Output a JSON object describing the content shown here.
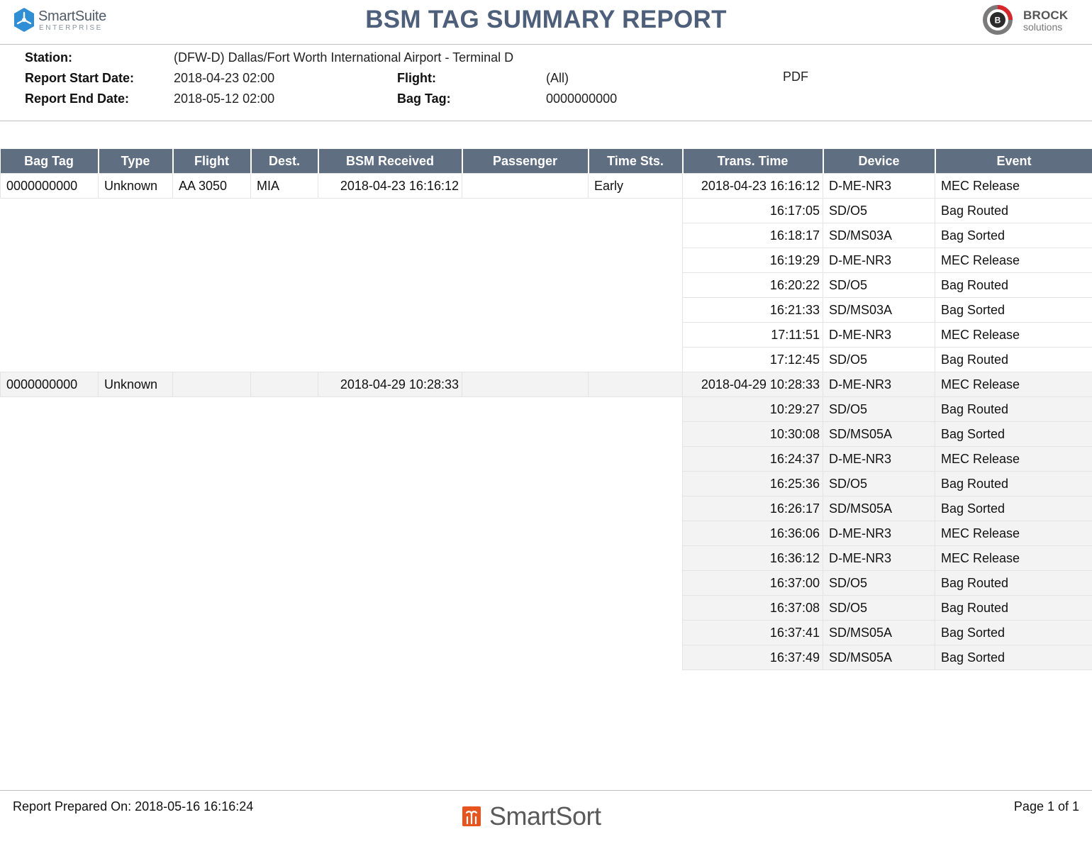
{
  "header": {
    "left_logo_name": "SmartSuite",
    "left_logo_sub": "ENTERPRISE",
    "title": "BSM TAG SUMMARY REPORT",
    "right_logo_name": "BROCK",
    "right_logo_sub": "solutions",
    "right_logo_letter": "B"
  },
  "params": {
    "station_label": "Station:",
    "station_value": "(DFW-D) Dallas/Fort Worth International Airport - Terminal D",
    "start_label": "Report Start Date:",
    "start_value": "2018-04-23 02:00",
    "end_label": "Report End Date:",
    "end_value": "2018-05-12 02:00",
    "flight_label": "Flight:",
    "flight_value": "(All)",
    "bagtag_label": "Bag Tag:",
    "bagtag_value": "0000000000",
    "format": "PDF"
  },
  "table": {
    "columns": [
      "Bag Tag",
      "Type",
      "Flight",
      "Dest.",
      "BSM Received",
      "Passenger",
      "Time Sts.",
      "Trans. Time",
      "Device",
      "Event"
    ],
    "groups": [
      {
        "bag_tag": "0000000000",
        "type": "Unknown",
        "flight": "AA 3050",
        "dest": "MIA",
        "bsm_received": "2018-04-23 16:16:12",
        "passenger": "",
        "time_sts": "Early",
        "events": [
          {
            "time": "2018-04-23 16:16:12",
            "device": "D-ME-NR3",
            "event": "MEC Release"
          },
          {
            "time": "16:17:05",
            "device": "SD/O5",
            "event": "Bag Routed"
          },
          {
            "time": "16:18:17",
            "device": "SD/MS03A",
            "event": "Bag Sorted"
          },
          {
            "time": "16:19:29",
            "device": "D-ME-NR3",
            "event": "MEC Release"
          },
          {
            "time": "16:20:22",
            "device": "SD/O5",
            "event": "Bag Routed"
          },
          {
            "time": "16:21:33",
            "device": "SD/MS03A",
            "event": "Bag Sorted"
          },
          {
            "time": "17:11:51",
            "device": "D-ME-NR3",
            "event": "MEC Release"
          },
          {
            "time": "17:12:45",
            "device": "SD/O5",
            "event": "Bag Routed"
          }
        ]
      },
      {
        "bag_tag": "0000000000",
        "type": "Unknown",
        "flight": "",
        "dest": "",
        "bsm_received": "2018-04-29 10:28:33",
        "passenger": "",
        "time_sts": "",
        "events": [
          {
            "time": "2018-04-29 10:28:33",
            "device": "D-ME-NR3",
            "event": "MEC Release"
          },
          {
            "time": "10:29:27",
            "device": "SD/O5",
            "event": "Bag Routed"
          },
          {
            "time": "10:30:08",
            "device": "SD/MS05A",
            "event": "Bag Sorted"
          },
          {
            "time": "16:24:37",
            "device": "D-ME-NR3",
            "event": "MEC Release"
          },
          {
            "time": "16:25:36",
            "device": "SD/O5",
            "event": "Bag Routed"
          },
          {
            "time": "16:26:17",
            "device": "SD/MS05A",
            "event": "Bag Sorted"
          },
          {
            "time": "16:36:06",
            "device": "D-ME-NR3",
            "event": "MEC Release"
          },
          {
            "time": "16:36:12",
            "device": "D-ME-NR3",
            "event": "MEC Release"
          },
          {
            "time": "16:37:00",
            "device": "SD/O5",
            "event": "Bag Routed"
          },
          {
            "time": "16:37:08",
            "device": "SD/O5",
            "event": "Bag Routed"
          },
          {
            "time": "16:37:41",
            "device": "SD/MS05A",
            "event": "Bag Sorted"
          },
          {
            "time": "16:37:49",
            "device": "SD/MS05A",
            "event": "Bag Sorted"
          }
        ]
      }
    ]
  },
  "footer": {
    "prepared": "Report Prepared On: 2018-05-16 16:16:24",
    "logo_name": "SmartSort",
    "page": "Page 1 of 1"
  },
  "colors": {
    "title": "#4d5f7a",
    "header_row": "#5f6e80",
    "shade_row": "#f3f3f3",
    "smartsuite_blue": "#2e8fd6",
    "brock_red": "#d9262b",
    "smartsort_orange": "#e8541e"
  }
}
